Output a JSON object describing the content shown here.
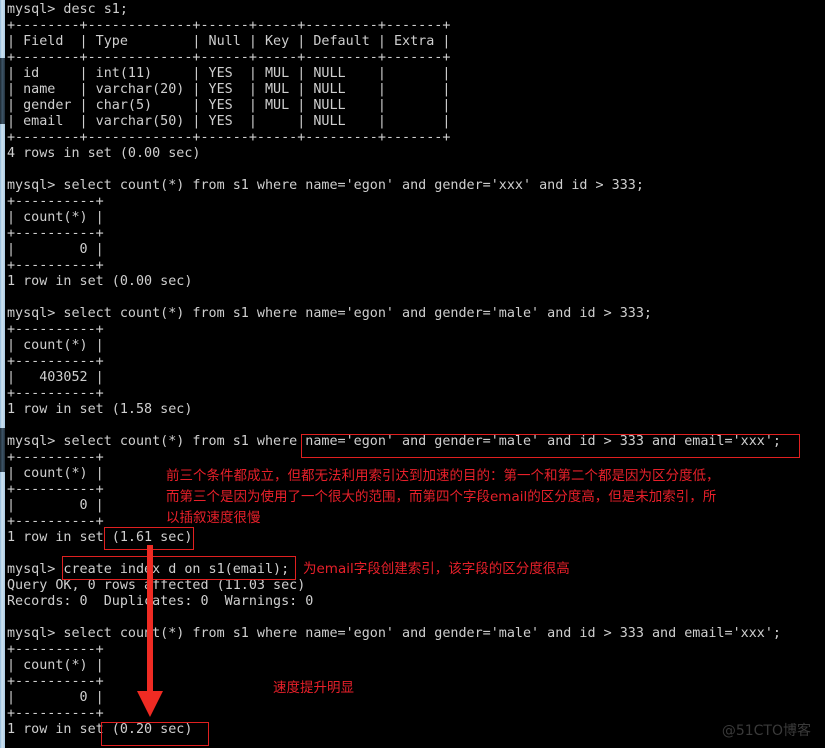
{
  "window": {
    "title": "mysql console",
    "background_color": "#000000",
    "text_color": "#cfcfcf",
    "annotation_color": "#e8202a"
  },
  "scrollbar": {
    "name": "vertical-scrollbar",
    "track_color": "#cfe2f0",
    "thumb_color": "#3e5568"
  },
  "console": {
    "lines": [
      "mysql> desc s1;",
      "+--------+-------------+------+-----+---------+-------+",
      "| Field  | Type        | Null | Key | Default | Extra |",
      "+--------+-------------+------+-----+---------+-------+",
      "| id     | int(11)     | YES  | MUL | NULL    |       |",
      "| name   | varchar(20) | YES  | MUL | NULL    |       |",
      "| gender | char(5)     | YES  | MUL | NULL    |       |",
      "| email  | varchar(50) | YES  |     | NULL    |       |",
      "+--------+-------------+------+-----+---------+-------+",
      "4 rows in set (0.00 sec)",
      "",
      "mysql> select count(*) from s1 where name='egon' and gender='xxx' and id > 333;",
      "+----------+",
      "| count(*) |",
      "+----------+",
      "|        0 |",
      "+----------+",
      "1 row in set (0.00 sec)",
      "",
      "mysql> select count(*) from s1 where name='egon' and gender='male' and id > 333;",
      "+----------+",
      "| count(*) |",
      "+----------+",
      "|   403052 |",
      "+----------+",
      "1 row in set (1.58 sec)",
      "",
      "mysql> select count(*) from s1 where name='egon' and gender='male' and id > 333 and email='xxx';",
      "+----------+",
      "| count(*) |",
      "+----------+",
      "|        0 |",
      "+----------+",
      "1 row in set (1.61 sec)",
      "",
      "mysql> create index d on s1(email);",
      "Query OK, 0 rows affected (11.03 sec)",
      "Records: 0  Duplicates: 0  Warnings: 0",
      "",
      "mysql> select count(*) from s1 where name='egon' and gender='male' and id > 333 and email='xxx';",
      "+----------+",
      "| count(*) |",
      "+----------+",
      "|        0 |",
      "+----------+",
      "1 row in set (0.20 sec)"
    ]
  },
  "annotations": {
    "where_clause_note": "前三个条件都成立，但都无法利用索引达到加速的目的：第一个和第二个都是因为区分度低，\n而第三个是因为使用了一个很大的范围，而第四个字段email的区分度高，但是未加索引，所\n以插叙速度很慢",
    "create_index_note": "为email字段创建索引，该字段的区分度很高",
    "speedup_note": "速度提升明显",
    "highlight_boxes": [
      {
        "name": "where-clause-highlight",
        "target": "name='egon' and gender='male' and id > 333 and email='xxx';"
      },
      {
        "name": "slow-timing-highlight",
        "target": "(1.61 sec)"
      },
      {
        "name": "create-index-highlight",
        "target": "create index d on s1(email);"
      },
      {
        "name": "fast-timing-highlight",
        "target": "(0.20 sec)"
      }
    ]
  },
  "watermark": {
    "text": "@51CTO博客"
  }
}
